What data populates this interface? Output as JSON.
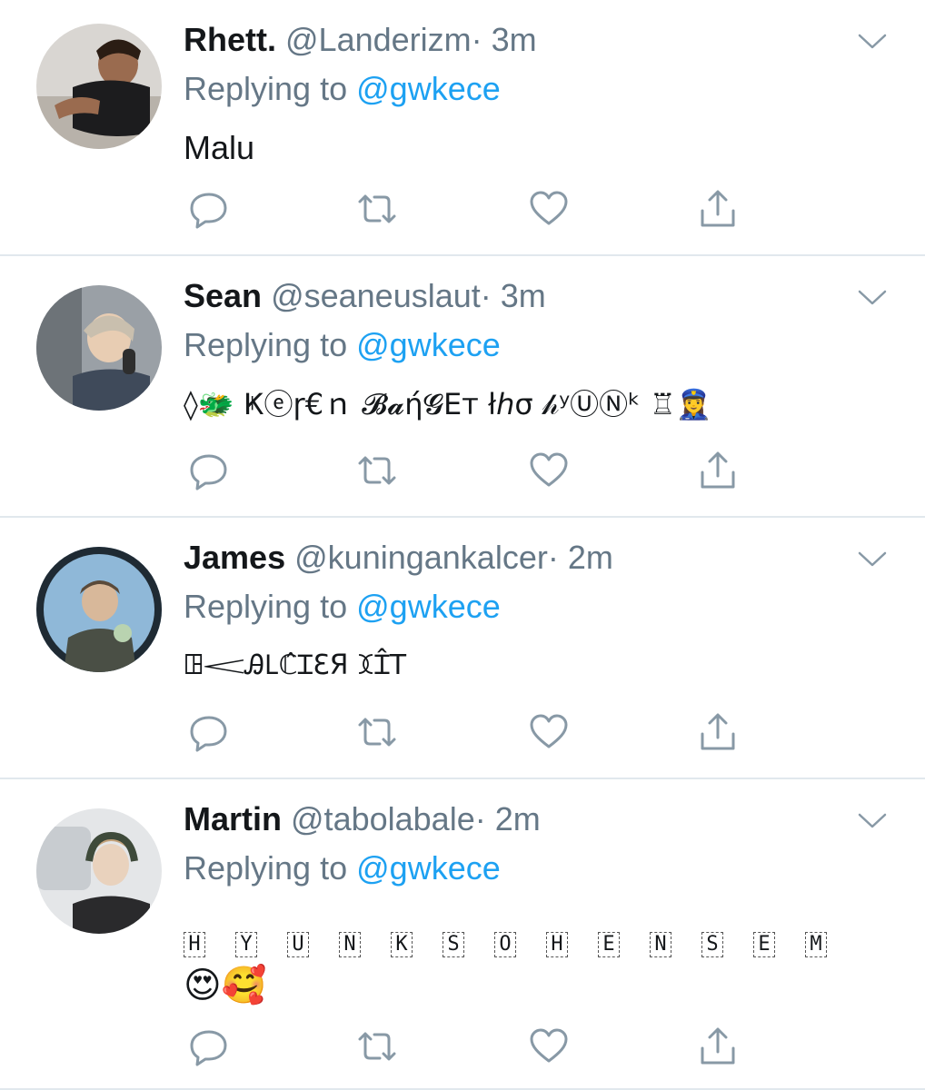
{
  "reply_prefix": "Replying to",
  "tweets": [
    {
      "name": "Rhett.",
      "handle": "@Landerizm",
      "time": "· 3m",
      "reply_to": "@gwkece",
      "text": "Malu",
      "avatar_icon": "person-photo-avatar"
    },
    {
      "name": "Sean",
      "handle": "@seaneuslaut",
      "time": "· 3m",
      "reply_to": "@gwkece",
      "text": "◊🐲 Ҝⓔɼ€ｎ 𝓑𝓪ή𝓖Εт łℎσ 𝒽ʸⓊⓃᵏ ♖👮‍♀️",
      "avatar_icon": "person-photo-avatar"
    },
    {
      "name": "James",
      "handle": "@kuningankalcer",
      "time": "· 2m",
      "reply_to": "@gwkece",
      "text": "ꖸ𝆒Ꭿ𐐛ℂ̂ꞮԐЯ ꘉꞮ̂ꓔ",
      "avatar_icon": "person-photo-avatar"
    },
    {
      "name": "Martin",
      "handle": "@tabolabale",
      "time": "· 2m",
      "reply_to": "@gwkece",
      "text_boxed": [
        "H",
        "Y",
        "U",
        "N",
        "K",
        "S",
        "O",
        "H",
        "E",
        "N",
        "S",
        "E",
        "M"
      ],
      "text_emoji": "😍🥰",
      "avatar_icon": "person-photo-avatar"
    }
  ],
  "colors": {
    "accent": "#1da1f2",
    "secondary_text": "#657786",
    "icon": "#8899a6",
    "divider": "#e1e8ed"
  },
  "action_icons": [
    "reply-icon",
    "retweet-icon",
    "like-icon",
    "share-icon"
  ]
}
